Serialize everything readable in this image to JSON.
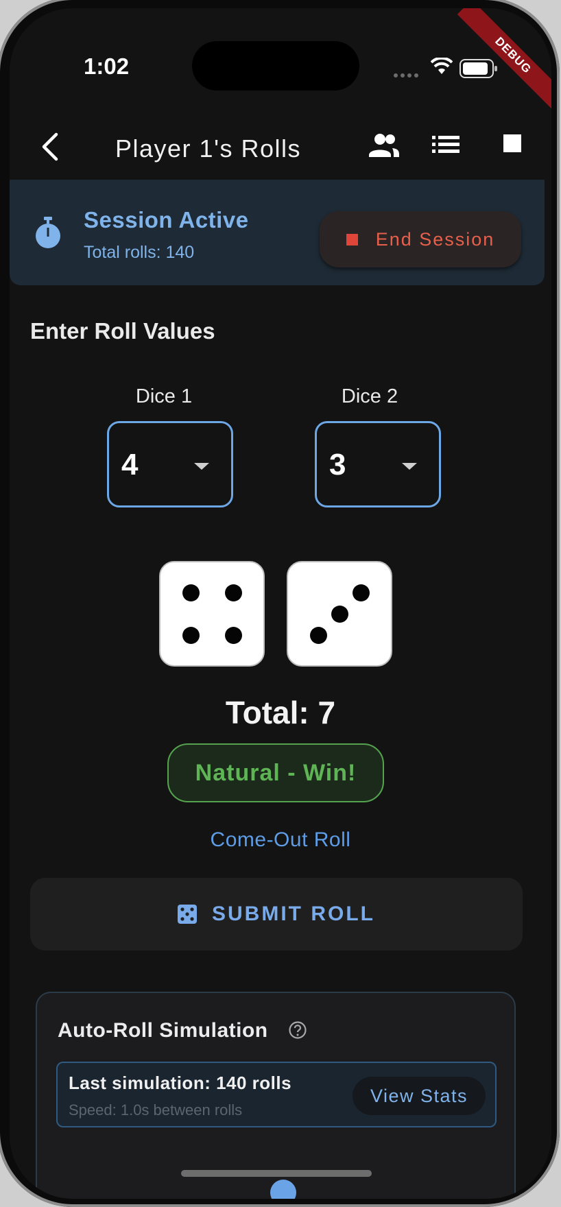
{
  "status_bar": {
    "time": "1:02",
    "debug_label": "DEBUG"
  },
  "app_bar": {
    "title": "Player 1's Rolls",
    "icons": [
      "back-arrow-icon",
      "people-icon",
      "list-icon",
      "stop-icon"
    ]
  },
  "session": {
    "title": "Session Active",
    "total_rolls_text": "Total rolls: 140",
    "end_button_label": "End Session"
  },
  "roll_entry": {
    "heading": "Enter Roll Values",
    "dice": [
      {
        "label": "Dice 1",
        "value": "4"
      },
      {
        "label": "Dice 2",
        "value": "3"
      }
    ]
  },
  "result": {
    "total_text": "Total: 7",
    "badge": "Natural - Win!",
    "roll_type": "Come-Out Roll"
  },
  "submit": {
    "label": "SUBMIT ROLL"
  },
  "auto_roll": {
    "title": "Auto-Roll Simulation",
    "last_sim": "Last simulation: 140 rolls",
    "speed": "Speed: 1.0s between rolls",
    "view_stats_label": "View Stats"
  },
  "colors": {
    "accent_blue": "#6da7e6",
    "win_green": "#5fb456",
    "end_red": "#e6604c",
    "background": "#131313"
  }
}
